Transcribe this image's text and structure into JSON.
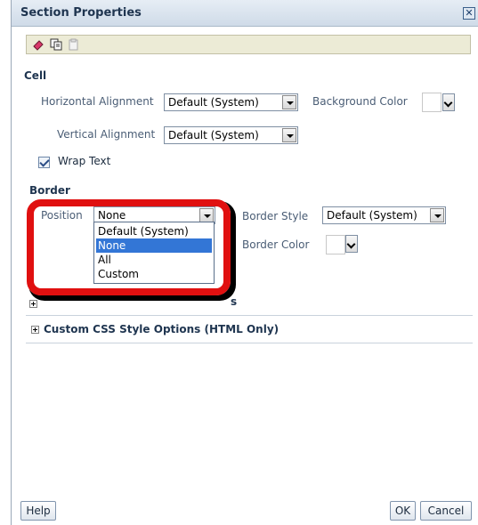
{
  "dialog": {
    "title": "Section Properties",
    "close_glyph": "✕"
  },
  "toolbar": {
    "icons": [
      "eraser-icon",
      "copy-icon",
      "paste-icon"
    ]
  },
  "cell": {
    "header": "Cell",
    "horizontal_alignment_label": "Horizontal Alignment",
    "horizontal_alignment_value": "Default (System)",
    "background_color_label": "Background Color",
    "vertical_alignment_label": "Vertical Alignment",
    "vertical_alignment_value": "Default (System)",
    "wrap_text_label": "Wrap Text",
    "wrap_text_checked": true
  },
  "border": {
    "header": "Border",
    "position_label": "Position",
    "position_value": "None",
    "position_options": [
      "Default (System)",
      "None",
      "All",
      "Custom"
    ],
    "position_selected_index": 1,
    "border_style_label": "Border Style",
    "border_style_value": "Default (System)",
    "border_color_label": "Border Color"
  },
  "sections": {
    "obscured_tail": "s",
    "custom_css_label": "Custom CSS Style Options (HTML Only)"
  },
  "footer": {
    "help_label": "Help",
    "ok_label": "OK",
    "cancel_label": "Cancel"
  },
  "colors": {
    "highlight": "#e01010",
    "selection": "#3376d6",
    "titlebar": "#cfdbe8"
  }
}
